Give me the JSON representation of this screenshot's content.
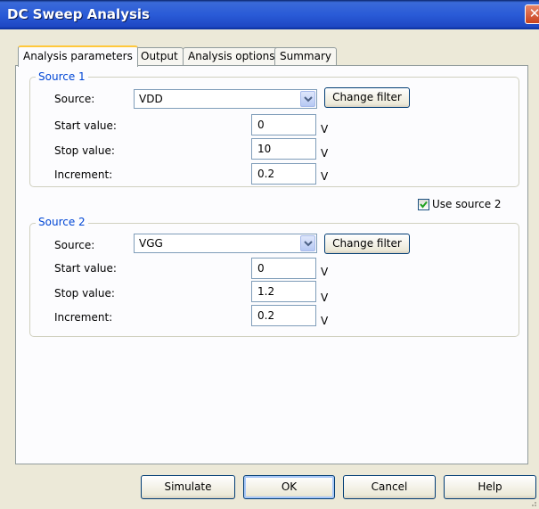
{
  "window": {
    "title": "DC Sweep Analysis",
    "close_glyph": "✕"
  },
  "tabs": [
    {
      "label": "Analysis parameters",
      "active": true
    },
    {
      "label": "Output",
      "active": false
    },
    {
      "label": "Analysis options",
      "active": false
    },
    {
      "label": "Summary",
      "active": false
    }
  ],
  "source1": {
    "legend": "Source 1",
    "source_label": "Source:",
    "source_value": "VDD",
    "change_filter": "Change filter",
    "start_label": "Start value:",
    "start_value": "0",
    "stop_label": "Stop value:",
    "stop_value": "10",
    "increment_label": "Increment:",
    "increment_value": "0.2",
    "unit": "V"
  },
  "use_source2": {
    "label": "Use source 2",
    "checked": true
  },
  "source2": {
    "legend": "Source 2",
    "source_label": "Source:",
    "source_value": "VGG",
    "change_filter": "Change filter",
    "start_label": "Start value:",
    "start_value": "0",
    "stop_label": "Stop value:",
    "stop_value": "1.2",
    "increment_label": "Increment:",
    "increment_value": "0.2",
    "unit": "V"
  },
  "buttons": {
    "simulate": "Simulate",
    "ok": "OK",
    "cancel": "Cancel",
    "help": "Help"
  },
  "icons": [
    "close-icon",
    "chevron-down-icon",
    "checkmark-icon",
    "resize-grip-icon"
  ]
}
